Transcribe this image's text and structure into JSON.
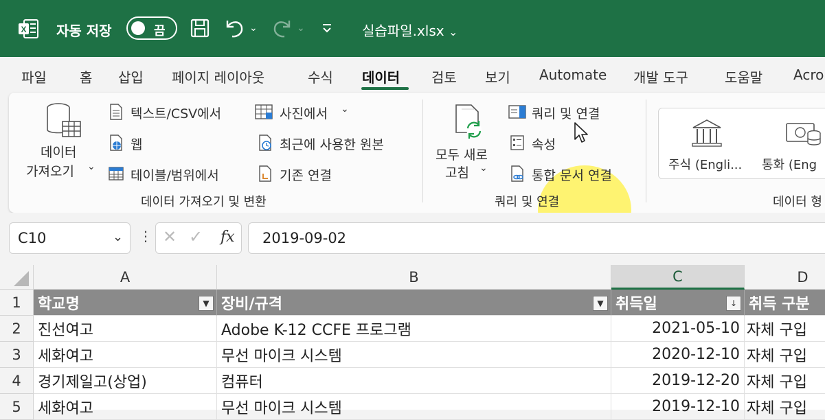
{
  "titlebar": {
    "autosave_label": "자동 저장",
    "autosave_state": "끔",
    "filename": "실습파일.xlsx",
    "accent": "#1e7145"
  },
  "tabs": [
    {
      "label": "파일"
    },
    {
      "label": "홈"
    },
    {
      "label": "삽입"
    },
    {
      "label": "페이지 레이아웃"
    },
    {
      "label": "수식"
    },
    {
      "label": "데이터",
      "active": true
    },
    {
      "label": "검토"
    },
    {
      "label": "보기"
    },
    {
      "label": "Automate"
    },
    {
      "label": "개발 도구"
    },
    {
      "label": "도움말"
    },
    {
      "label": "Acro"
    }
  ],
  "ribbon": {
    "get_data": {
      "line1": "데이터",
      "line2": "가져오기"
    },
    "text_csv": "텍스트/CSV에서",
    "web": "웹",
    "table_range": "테이블/범위에서",
    "from_picture": "사진에서",
    "recent_sources": "최근에 사용한 원본",
    "existing_connections": "기존 연결",
    "group1_label": "데이터 가져오기 및 변환",
    "refresh_all": {
      "line1": "모두 새로",
      "line2": "고침"
    },
    "queries_connections": "쿼리 및 연결",
    "properties": "속성",
    "workbook_links": "통합 문서 연결",
    "group2_label": "쿼리 및 연결",
    "stocks": "주식 (Engli...",
    "currencies": "통화 (Eng",
    "group3_label": "데이터 형"
  },
  "formula_bar": {
    "name_box": "C10",
    "formula": "2019-09-02"
  },
  "grid": {
    "columns": [
      "A",
      "B",
      "C",
      "D"
    ],
    "selected_column": "C",
    "row_numbers": [
      "1",
      "2",
      "3",
      "4",
      "5"
    ],
    "header_row": [
      "학교명",
      "장비/규격",
      "취득일",
      "취득 구분"
    ],
    "rows": [
      [
        "진선여고",
        "Adobe K-12 CCFE 프로그램",
        "2021-05-10",
        "자체 구입"
      ],
      [
        "세화여고",
        "무선 마이크 시스템",
        "2020-12-10",
        "자체 구입"
      ],
      [
        "경기제일고(상업)",
        "컴퓨터",
        "2019-12-20",
        "자체 구입"
      ],
      [
        "세화여고",
        "무선 마이크 시스템",
        "2019-12-10",
        "자체 구입"
      ]
    ]
  }
}
